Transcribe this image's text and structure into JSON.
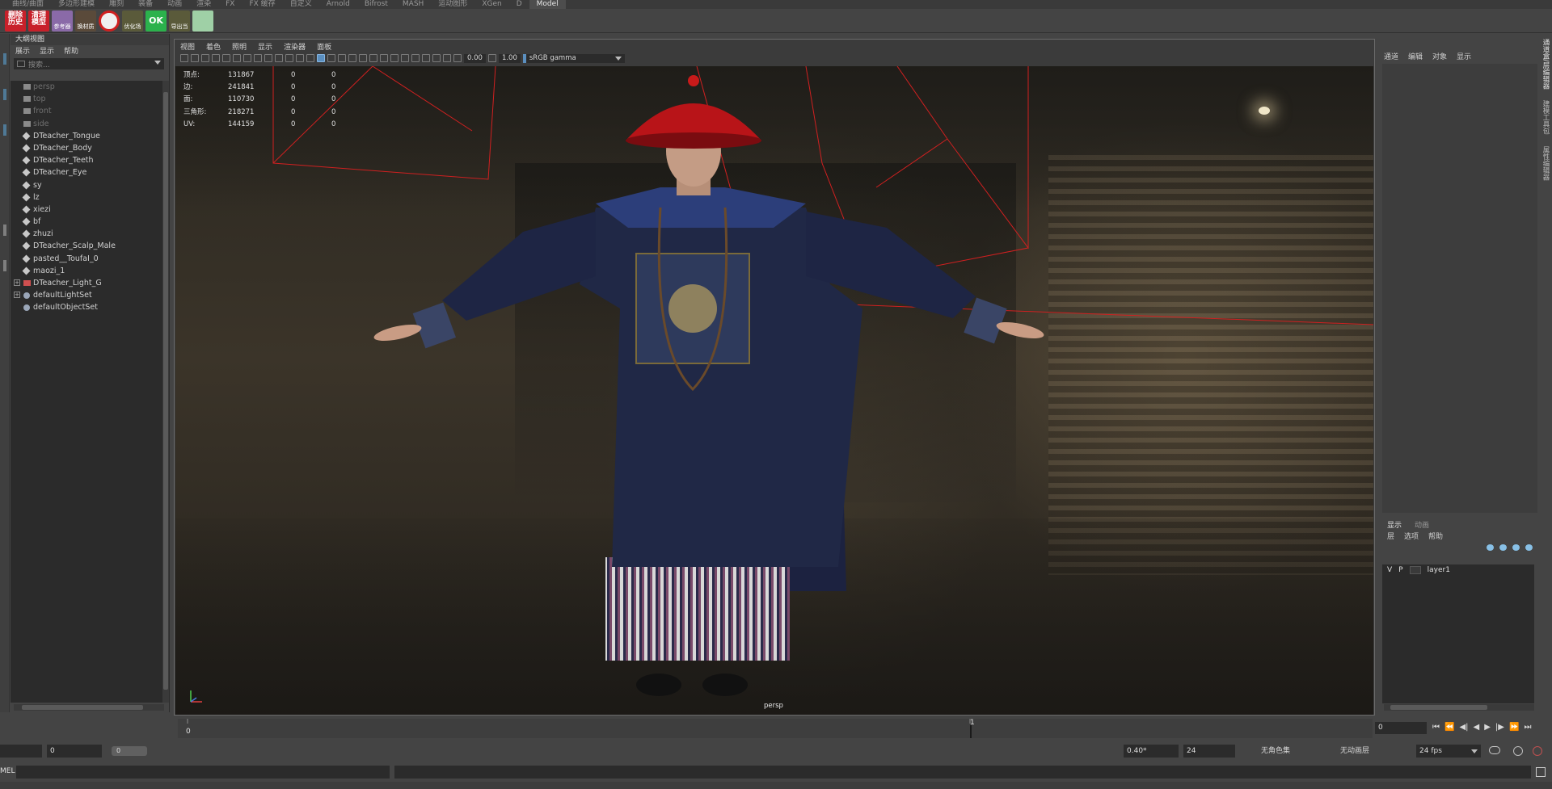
{
  "shelf_tabs": [
    {
      "label": "曲线/曲面",
      "active": false
    },
    {
      "label": "多边形建模",
      "active": false
    },
    {
      "label": "雕刻",
      "active": false
    },
    {
      "label": "装备",
      "active": false
    },
    {
      "label": "动画",
      "active": false
    },
    {
      "label": "渲染",
      "active": false
    },
    {
      "label": "FX",
      "active": false
    },
    {
      "label": "FX 缓存",
      "active": false
    },
    {
      "label": "自定义",
      "active": false
    },
    {
      "label": "Arnold",
      "active": false
    },
    {
      "label": "Bifrost",
      "active": false
    },
    {
      "label": "MASH",
      "active": false
    },
    {
      "label": "运动图形",
      "active": false
    },
    {
      "label": "XGen",
      "active": false
    },
    {
      "label": "D",
      "active": false
    },
    {
      "label": "Model",
      "active": true
    }
  ],
  "shelf_icons": [
    {
      "name": "delete-history-icon",
      "text": "删除\n历史",
      "bg": "#c8202a"
    },
    {
      "name": "clear-model-icon",
      "text": "清理\n模型",
      "bg": "#c8202a"
    },
    {
      "name": "avatar-tool-icon",
      "text": "",
      "label": "参考器",
      "bg": "#8a6aa8"
    },
    {
      "name": "material-tool-icon",
      "text": "",
      "label": "换材质",
      "bg": "#5a4a3a"
    },
    {
      "name": "forbid-icon",
      "text": "",
      "bg": "#e8e8e8"
    },
    {
      "name": "optimize-icon",
      "text": "",
      "label": "优化场",
      "bg": "#5a5a3a"
    },
    {
      "name": "ok-icon",
      "text": "OK",
      "bg": "#2bb24c"
    },
    {
      "name": "export-icon",
      "text": "",
      "label": "导出当",
      "bg": "#5a5a3a"
    },
    {
      "name": "dice-icon",
      "text": "",
      "bg": "#9fd0a6"
    }
  ],
  "outliner": {
    "title": "大纲视图",
    "menu": [
      "展示",
      "显示",
      "帮助"
    ],
    "search_placeholder": "搜索...",
    "items": [
      {
        "label": "persp",
        "dim": true,
        "type": "camera"
      },
      {
        "label": "top",
        "dim": true,
        "type": "camera"
      },
      {
        "label": "front",
        "dim": true,
        "type": "camera"
      },
      {
        "label": "side",
        "dim": true,
        "type": "camera"
      },
      {
        "label": "DTeacher_Tongue",
        "dim": false,
        "type": "mesh"
      },
      {
        "label": "DTeacher_Body",
        "dim": false,
        "type": "mesh"
      },
      {
        "label": "DTeacher_Teeth",
        "dim": false,
        "type": "mesh"
      },
      {
        "label": "DTeacher_Eye",
        "dim": false,
        "type": "mesh"
      },
      {
        "label": "sy",
        "dim": false,
        "type": "mesh"
      },
      {
        "label": "lz",
        "dim": false,
        "type": "mesh"
      },
      {
        "label": "xiezi",
        "dim": false,
        "type": "mesh"
      },
      {
        "label": "bf",
        "dim": false,
        "type": "mesh"
      },
      {
        "label": "zhuzi",
        "dim": false,
        "type": "mesh"
      },
      {
        "label": "DTeacher_Scalp_Male",
        "dim": false,
        "type": "mesh"
      },
      {
        "label": "pasted__ToufaI_0",
        "dim": false,
        "type": "mesh"
      },
      {
        "label": "maozi_1",
        "dim": false,
        "type": "mesh"
      },
      {
        "label": "DTeacher_Light_G",
        "dim": false,
        "type": "light-group"
      },
      {
        "label": "defaultLightSet",
        "dim": false,
        "type": "set"
      },
      {
        "label": "defaultObjectSet",
        "dim": false,
        "type": "set"
      }
    ]
  },
  "viewport": {
    "menu": [
      "视图",
      "着色",
      "照明",
      "显示",
      "渲染器",
      "面板"
    ],
    "exposure": "0.00",
    "gamma": "1.00",
    "color_space": "sRGB gamma",
    "camera": "persp",
    "hud": [
      {
        "key": "顶点:",
        "v1": "131867",
        "v2": "0",
        "v3": "0"
      },
      {
        "key": "边:",
        "v1": "241841",
        "v2": "0",
        "v3": "0"
      },
      {
        "key": "面:",
        "v1": "110730",
        "v2": "0",
        "v3": "0"
      },
      {
        "key": "三角形:",
        "v1": "218271",
        "v2": "0",
        "v3": "0"
      },
      {
        "key": "UV:",
        "v1": "144159",
        "v2": "0",
        "v3": "0"
      }
    ]
  },
  "channel_box": {
    "menu": [
      "通道",
      "编辑",
      "对象",
      "显示"
    ]
  },
  "right_vtabs": [
    "通道盒/层编辑器",
    "建模工具包",
    "属性编辑器"
  ],
  "layer_editor": {
    "tabs": [
      "显示",
      "动画"
    ],
    "active_tab": "显示",
    "menu": [
      "层",
      "选项",
      "帮助"
    ],
    "layers": [
      {
        "v": "V",
        "p": "P",
        "name": "layer1"
      }
    ]
  },
  "time_slider": {
    "start_label": "0",
    "mid_label": "1",
    "current_frame": "0",
    "playback_icons": [
      "go-to-start-icon",
      "step-back-key-icon",
      "step-back-frame-icon",
      "play-back-icon",
      "play-forward-icon",
      "step-forward-frame-icon",
      "step-forward-key-icon",
      "go-to-end-icon"
    ]
  },
  "range_slider": {
    "start": "",
    "anim_start": "0",
    "toggle": "0",
    "anim_end": "0.40*",
    "end": "24",
    "character_set": "无角色集",
    "anim_layer": "无动画层",
    "fps": "24 fps"
  },
  "command_line": {
    "mel_label": "MEL"
  },
  "colors": {
    "accent": "#5b8fbf",
    "guide_red": "#d02020",
    "hat_red": "#b81418",
    "robe": "#1d2440"
  }
}
